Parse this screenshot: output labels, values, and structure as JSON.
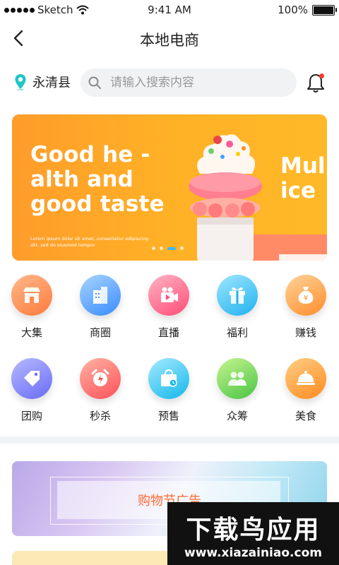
{
  "status_bar": {
    "carrier": "Sketch",
    "time": "9:41 AM",
    "battery": "100%"
  },
  "nav": {
    "title": "本地电商"
  },
  "location": {
    "name": "永清县"
  },
  "search": {
    "placeholder": "请输入搜索内容",
    "value": ""
  },
  "banner": {
    "headline": "Good he -\nalth and\ngood taste",
    "body": "Lorem ipsum dolor sit amet, consectetur edipiscing elit, sed do eiusmod tempor.",
    "side_text": "Mul\nice",
    "slide_count": 4,
    "active_slide": 3
  },
  "categories": [
    {
      "label": "大集",
      "icon": "shop-icon",
      "color_a": "#ffb98a",
      "color_b": "#ff7a3c"
    },
    {
      "label": "商圈",
      "icon": "buildings-icon",
      "color_a": "#a7d5ff",
      "color_b": "#3a8bff"
    },
    {
      "label": "直播",
      "icon": "video-camera-icon",
      "color_a": "#ffb3c4",
      "color_b": "#ff4d77"
    },
    {
      "label": "福利",
      "icon": "gift-icon",
      "color_a": "#9fe6ff",
      "color_b": "#1fb2ee"
    },
    {
      "label": "赚钱",
      "icon": "money-bag-icon",
      "color_a": "#ffd39a",
      "color_b": "#ff8d2a"
    },
    {
      "label": "团购",
      "icon": "tag-icon",
      "color_a": "#b6b9ff",
      "color_b": "#6a6cf4"
    },
    {
      "label": "秒杀",
      "icon": "alarm-clock-icon",
      "color_a": "#ffb4a4",
      "color_b": "#ff5057"
    },
    {
      "label": "预售",
      "icon": "shopping-bag-icon",
      "color_a": "#a5eaff",
      "color_b": "#13b7ea"
    },
    {
      "label": "众筹",
      "icon": "group-icon",
      "color_a": "#c6f58f",
      "color_b": "#49c444"
    },
    {
      "label": "美食",
      "icon": "dish-cloche-icon",
      "color_a": "#ffcf85",
      "color_b": "#ff8a1e"
    }
  ],
  "ad": {
    "label": "购物节广告"
  },
  "watermark": {
    "title": "下载鸟应用",
    "url": "www.xiazainiao.com"
  }
}
